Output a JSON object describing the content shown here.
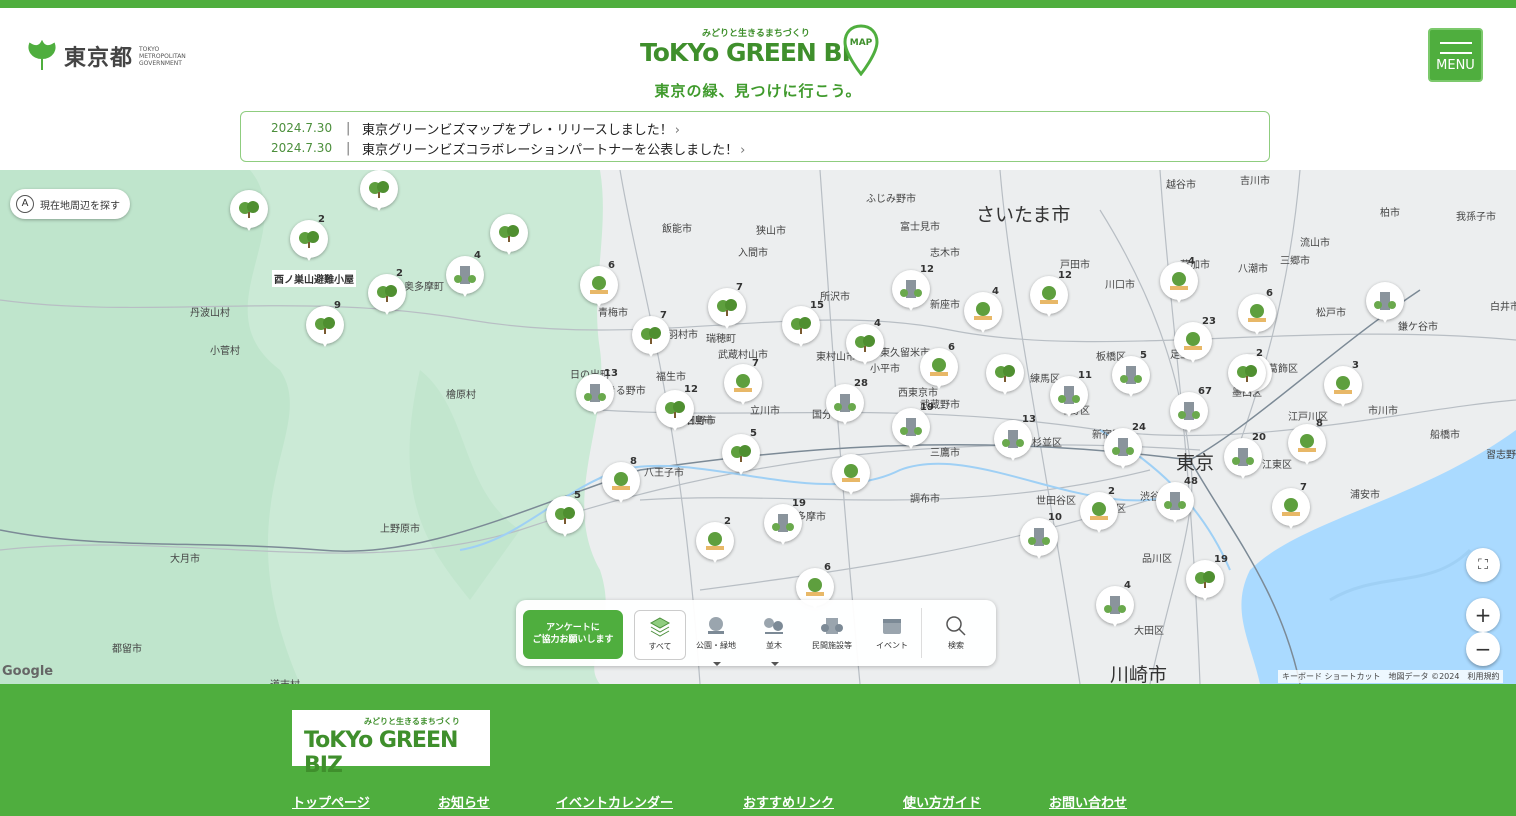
{
  "header": {
    "gov_name": "東京都",
    "gov_name_en": "TOKYO METROPOLITAN GOVERNMENT",
    "brand_sub": "みどりと生きるまちづくり",
    "brand_main": "ToKYo GREEN BIZ",
    "brand_badge": "MAP",
    "tagline": "東京の緑、見つけに行こう。",
    "menu_label": "MENU"
  },
  "news": [
    {
      "date": "2024.7.30",
      "sep": "|",
      "text": "東京グリーンビズマップをプレ・リリースしました！"
    },
    {
      "date": "2024.7.30",
      "sep": "|",
      "text": "東京グリーンビズコラボレーションパートナーを公表しました！"
    }
  ],
  "map": {
    "locate_label": "現在地周辺を探す",
    "locate_icon": "A",
    "google": "Google",
    "attribution": "キーボード ショートカット　地図データ ©2024　利用規約",
    "zoom_in": "+",
    "zoom_out": "−",
    "fullscreen": "⛶",
    "place_labels": [
      {
        "text": "さいたま市",
        "big": true
      },
      {
        "text": "越谷市"
      },
      {
        "text": "吉川市"
      },
      {
        "text": "柏市"
      },
      {
        "text": "我孫子市"
      },
      {
        "text": "ふじみ野市"
      },
      {
        "text": "富士見市"
      },
      {
        "text": "志木市"
      },
      {
        "text": "飯能市"
      },
      {
        "text": "狭山市"
      },
      {
        "text": "入間市"
      },
      {
        "text": "所沢市"
      },
      {
        "text": "新座市"
      },
      {
        "text": "戸田市"
      },
      {
        "text": "川口市"
      },
      {
        "text": "草加市"
      },
      {
        "text": "八潮市"
      },
      {
        "text": "三郷市"
      },
      {
        "text": "流山市"
      },
      {
        "text": "松戸市"
      },
      {
        "text": "鎌ケ谷市"
      },
      {
        "text": "白井市"
      },
      {
        "text": "丹波山村"
      },
      {
        "text": "小菅村"
      },
      {
        "text": "奥多摩町"
      },
      {
        "text": "青梅市"
      },
      {
        "text": "羽村市"
      },
      {
        "text": "瑞穂町"
      },
      {
        "text": "武蔵村山市"
      },
      {
        "text": "東村山市"
      },
      {
        "text": "東久留米市"
      },
      {
        "text": "檜原村"
      },
      {
        "text": "あきる野市"
      },
      {
        "text": "日の出町"
      },
      {
        "text": "福生市"
      },
      {
        "text": "昭島市"
      },
      {
        "text": "立川市"
      },
      {
        "text": "国分寺市"
      },
      {
        "text": "西東京市"
      },
      {
        "text": "武蔵野市"
      },
      {
        "text": "練馬区"
      },
      {
        "text": "板橋区"
      },
      {
        "text": "足立区"
      },
      {
        "text": "葛飾区"
      },
      {
        "text": "江戸川区"
      },
      {
        "text": "市川市"
      },
      {
        "text": "船橋市"
      },
      {
        "text": "習志野市"
      },
      {
        "text": "浦安市"
      },
      {
        "text": "八王子市"
      },
      {
        "text": "日野市"
      },
      {
        "text": "多摩市"
      },
      {
        "text": "調布市"
      },
      {
        "text": "三鷹市"
      },
      {
        "text": "杉並区"
      },
      {
        "text": "新宿区"
      },
      {
        "text": "渋谷区"
      },
      {
        "text": "世田谷区"
      },
      {
        "text": "目黒区"
      },
      {
        "text": "品川区"
      },
      {
        "text": "大田区"
      },
      {
        "text": "上野原市"
      },
      {
        "text": "大月市"
      },
      {
        "text": "都留市"
      },
      {
        "text": "道志村"
      },
      {
        "text": "東京",
        "big": true
      },
      {
        "text": "川崎市",
        "big": true
      },
      {
        "text": "江東区"
      },
      {
        "text": "墨田区"
      },
      {
        "text": "中野区"
      },
      {
        "text": "小平市"
      }
    ],
    "poi": "酉ノ巣山避難小屋",
    "markers": [
      {
        "count": ""
      },
      {
        "count": ""
      },
      {
        "count": "2"
      },
      {
        "count": ""
      },
      {
        "count": "2"
      },
      {
        "count": "4"
      },
      {
        "count": "9"
      },
      {
        "count": ""
      },
      {
        "count": "6"
      },
      {
        "count": "7"
      },
      {
        "count": "7"
      },
      {
        "count": "15"
      },
      {
        "count": "4"
      },
      {
        "count": "12"
      },
      {
        "count": "4"
      },
      {
        "count": "12"
      },
      {
        "count": "4"
      },
      {
        "count": "6"
      },
      {
        "count": ""
      },
      {
        "count": "13"
      },
      {
        "count": "12"
      },
      {
        "count": "7"
      },
      {
        "count": "28"
      },
      {
        "count": "6"
      },
      {
        "count": ""
      },
      {
        "count": "5"
      },
      {
        "count": "11"
      },
      {
        "count": "23"
      },
      {
        "count": "2"
      },
      {
        "count": "3"
      },
      {
        "count": "19"
      },
      {
        "count": "13"
      },
      {
        "count": "67"
      },
      {
        "count": "8"
      },
      {
        "count": "5"
      },
      {
        "count": "8"
      },
      {
        "count": ""
      },
      {
        "count": "24"
      },
      {
        "count": "20"
      },
      {
        "count": "5"
      },
      {
        "count": "2"
      },
      {
        "count": "19"
      },
      {
        "count": "48"
      },
      {
        "count": "7"
      },
      {
        "count": "10"
      },
      {
        "count": "2"
      },
      {
        "count": "6"
      },
      {
        "count": "19"
      },
      {
        "count": "4"
      }
    ]
  },
  "toolbar": {
    "survey_line1": "アンケートに",
    "survey_line2": "ご協力お願いします",
    "items": [
      {
        "label": "すべて"
      },
      {
        "label": "公園・緑地"
      },
      {
        "label": "並木"
      },
      {
        "label": "民間施設等"
      },
      {
        "label": "イベント"
      },
      {
        "label": "検索"
      }
    ]
  },
  "footer": {
    "logo_sub": "みどりと生きるまちづくり",
    "logo_main": "ToKYo GREEN BIZ",
    "nav": [
      {
        "label": "トップページ"
      },
      {
        "label": "お知らせ"
      },
      {
        "label": "イベントカレンダー"
      },
      {
        "label": "おすすめリンク"
      },
      {
        "label": "使い方ガイド"
      },
      {
        "label": "お問い合わせ"
      }
    ]
  },
  "colors": {
    "brand_green": "#4fae3e",
    "text_green": "#3f8f2c",
    "water": "#aadaff",
    "forest": "#cbead6"
  }
}
